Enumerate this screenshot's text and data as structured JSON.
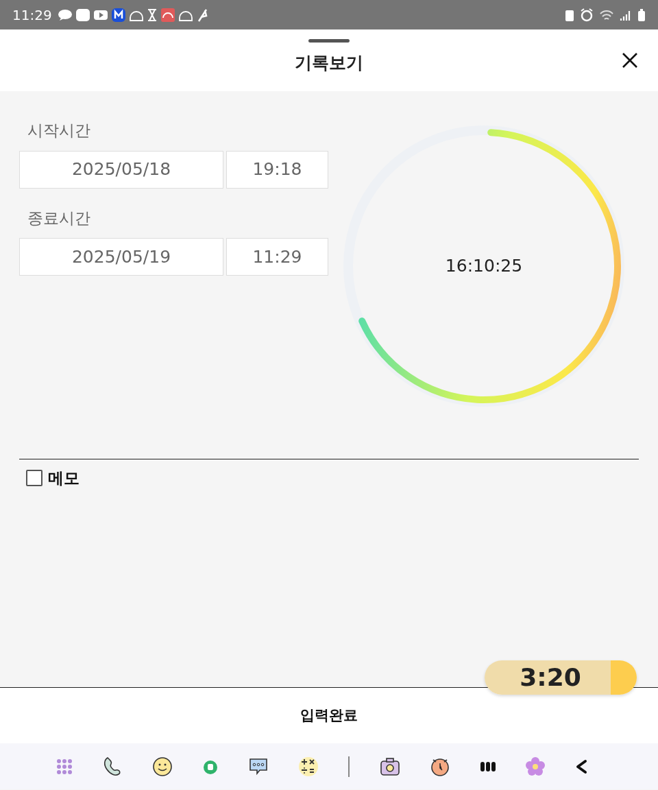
{
  "status_bar": {
    "time": "11:29"
  },
  "header": {
    "title": "기록보기"
  },
  "start": {
    "label": "시작시간",
    "date": "2025/05/18",
    "time": "19:18"
  },
  "end": {
    "label": "종료시간",
    "date": "2025/05/19",
    "time": "11:29"
  },
  "duration": {
    "text": "16:10:25",
    "level": 0.674
  },
  "memo": {
    "label": "메모",
    "checked": false
  },
  "floating_timer": {
    "text": "3:20"
  },
  "submit": {
    "label": "입력완료"
  }
}
